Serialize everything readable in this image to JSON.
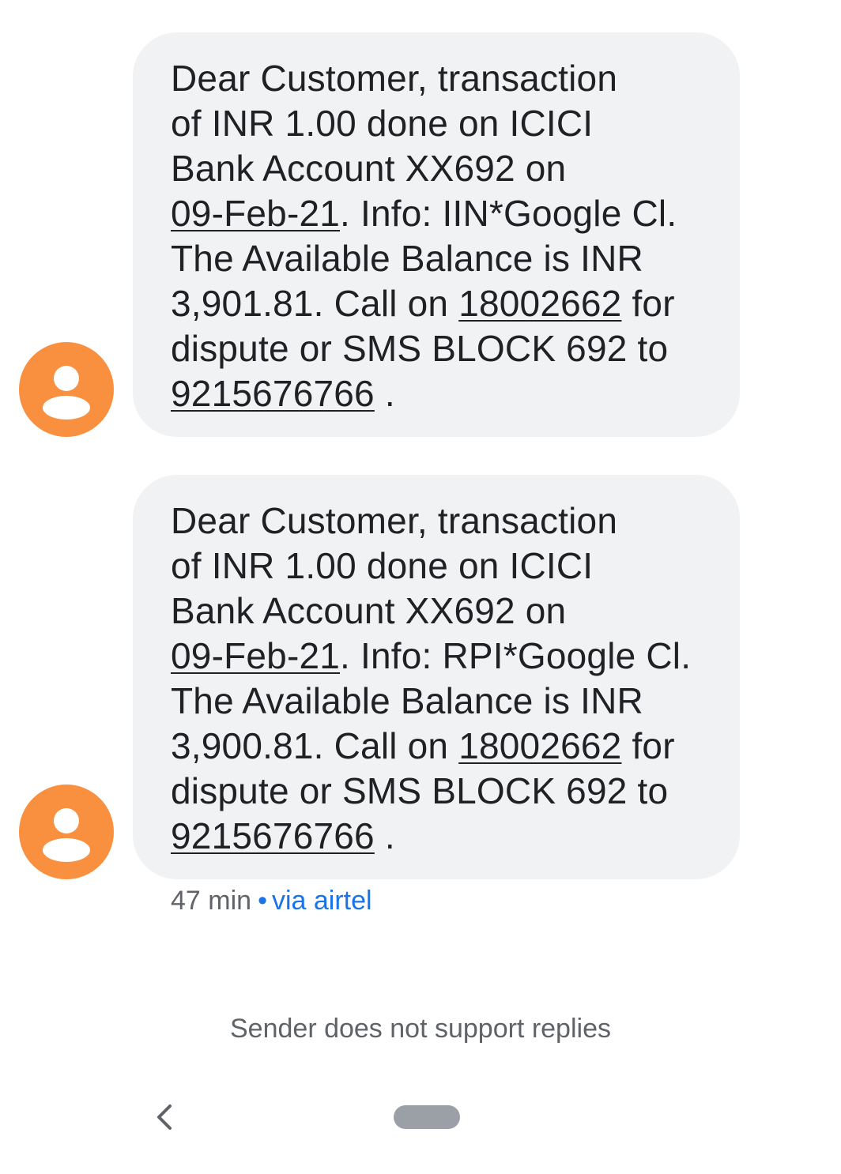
{
  "messages": [
    {
      "lines": [
        [
          "Dear Customer, transaction"
        ],
        [
          "of INR 1.00 done on ICICI"
        ],
        [
          "Bank Account XX692 on"
        ],
        [
          {
            "link": "09-Feb-21"
          },
          ". Info: IIN*Google Cl."
        ],
        [
          "The Available Balance is INR"
        ],
        [
          "3,901.81. Call on ",
          {
            "link": "18002662"
          },
          " for"
        ],
        [
          "dispute or SMS BLOCK 692 to"
        ],
        [
          {
            "link": "9215676766"
          },
          " ."
        ]
      ]
    },
    {
      "lines": [
        [
          "Dear Customer, transaction"
        ],
        [
          "of INR 1.00 done on ICICI"
        ],
        [
          "Bank Account XX692 on"
        ],
        [
          {
            "link": "09-Feb-21"
          },
          ". Info: RPI*Google Cl."
        ],
        [
          "The Available Balance is INR"
        ],
        [
          "3,900.81. Call on ",
          {
            "link": "18002662"
          },
          " for"
        ],
        [
          "dispute or SMS BLOCK 692 to"
        ],
        [
          {
            "link": "9215676766"
          },
          " ."
        ]
      ]
    }
  ],
  "meta": {
    "time": "47 min",
    "separator": "•",
    "carrier": "via airtel"
  },
  "footer": {
    "no_reply": "Sender does not support replies"
  },
  "icons": {
    "avatar": "person-icon",
    "back": "chevron-left-icon",
    "home": "home-pill"
  },
  "colors": {
    "avatar_bg": "#f8903f",
    "bubble_bg": "#f1f2f4",
    "link_accent": "#1a73e8",
    "nav_pill": "#9aa0a6"
  }
}
